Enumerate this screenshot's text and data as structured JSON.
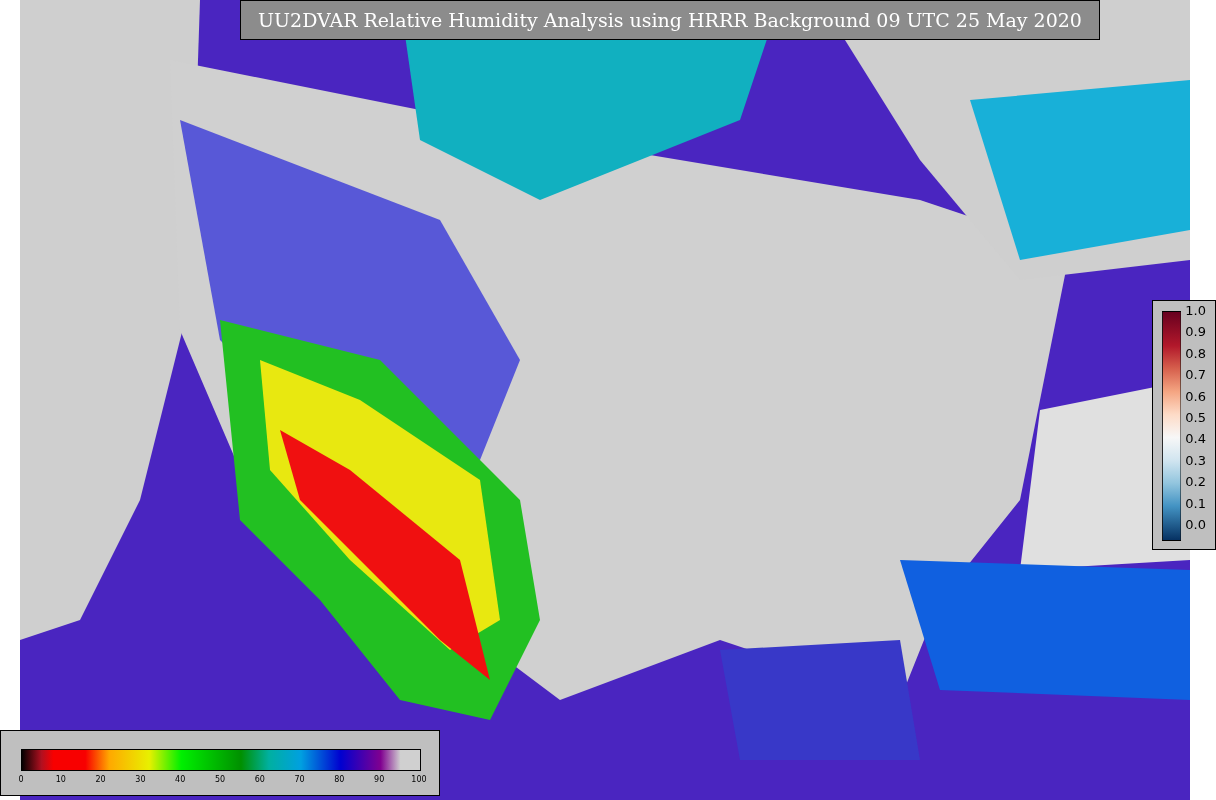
{
  "title": "UU2DVAR Relative Humidity Analysis using HRRR Background 09 UTC 25 May 2020",
  "ratio_scale": {
    "ticks": [
      "1.0",
      "0.9",
      "0.8",
      "0.7",
      "0.6",
      "0.5",
      "0.4",
      "0.3",
      "0.2",
      "0.1",
      "0.0"
    ]
  },
  "humidity_scale": {
    "ticks": [
      "0",
      "10",
      "20",
      "30",
      "40",
      "50",
      "60",
      "70",
      "80",
      "90",
      "100"
    ]
  }
}
